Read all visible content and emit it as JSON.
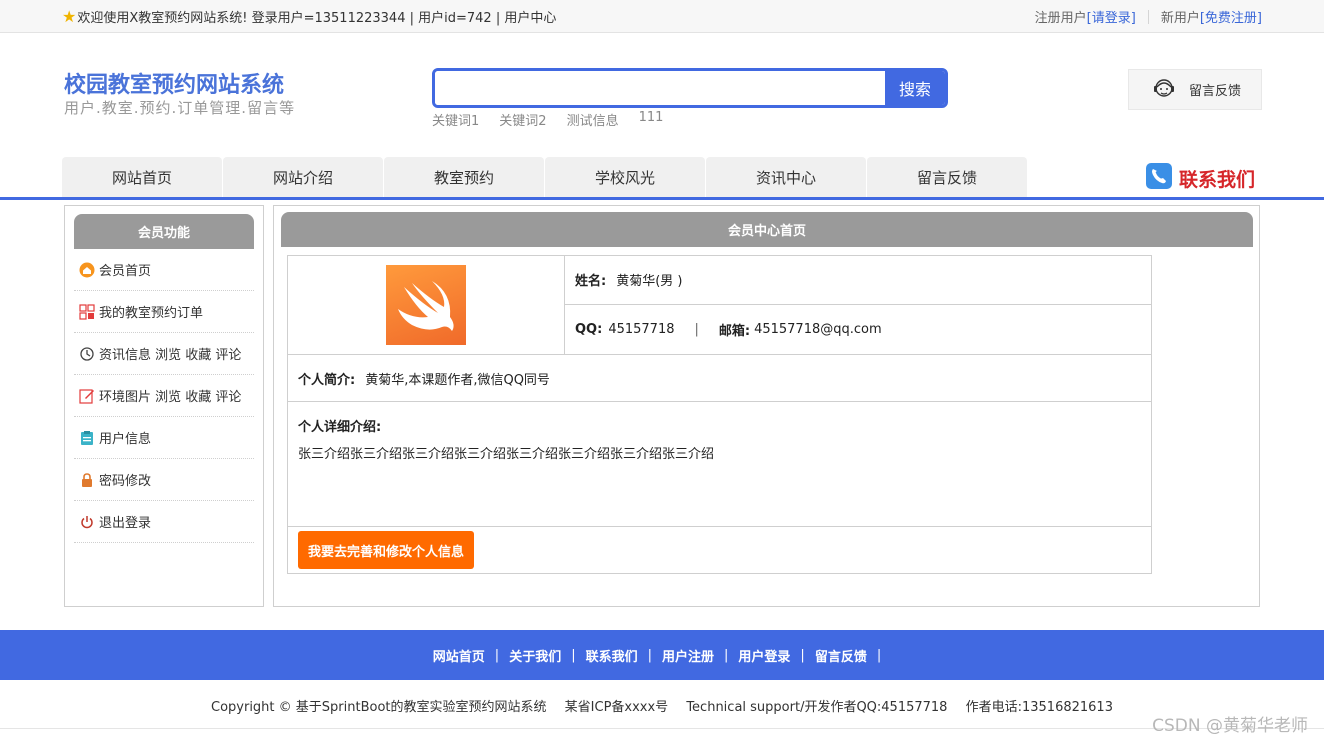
{
  "topbar": {
    "welcome": "欢迎使用X教室预约网站系统!  登录用户=13511223344 | 用户id=742 | 用户中心",
    "registered_label": "注册用户",
    "login_link": "[请登录]",
    "new_user_label": "新用户",
    "register_link": "[免费注册]"
  },
  "header": {
    "title": "校园教室预约网站系统",
    "subtitle": "用户.教室.预约.订单管理.留言等",
    "search": {
      "placeholder": "",
      "button": "搜索",
      "keywords": [
        "关键词1",
        "关键词2",
        "测试信息",
        "111"
      ]
    },
    "feedback": "留言反馈",
    "contact": "联系我们"
  },
  "nav": {
    "items": [
      "网站首页",
      "网站介绍",
      "教室预约",
      "学校风光",
      "资讯中心",
      "留言反馈"
    ]
  },
  "sidebar": {
    "title": "会员功能",
    "items": [
      {
        "label": "会员首页",
        "icon": "home-icon"
      },
      {
        "label": "我的教室预约订单",
        "icon": "grid-icon"
      },
      {
        "label": "资讯信息 浏览 收藏 评论",
        "icon": "history-icon"
      },
      {
        "label": "环境图片 浏览 收藏 评论",
        "icon": "edit-icon"
      },
      {
        "label": "用户信息",
        "icon": "clipboard-icon"
      },
      {
        "label": "密码修改",
        "icon": "lock-icon"
      },
      {
        "label": "退出登录",
        "icon": "power-icon"
      }
    ]
  },
  "main": {
    "title": "会员中心首页",
    "name_label": "姓名:",
    "name_value": "黄菊华(男 )",
    "qq_label": "QQ:",
    "qq_value": "45157718",
    "email_label": "邮箱:",
    "email_value": "45157718@qq.com",
    "intro_label": "个人简介:",
    "intro_value": "黄菊华,本课题作者,微信QQ同号",
    "detail_label": "个人详细介绍:",
    "detail_value": "张三介绍张三介绍张三介绍张三介绍张三介绍张三介绍张三介绍张三介绍",
    "edit_button": "我要去完善和修改个人信息"
  },
  "footer": {
    "nav": [
      "网站首页",
      "关于我们",
      "联系我们",
      "用户注册",
      "用户登录",
      "留言反馈"
    ],
    "copyright": "Copyright © 基于SprintBoot的教室实验室预约网站系统",
    "icp": "某省ICP备xxxx号",
    "support": "Technical support/开发作者QQ:45157718",
    "phone": "作者电话:13516821613"
  },
  "watermark": "CSDN @黄菊华老师",
  "colors": {
    "primary": "#4169e1",
    "accent": "#ff6a00",
    "header_gray": "#9a9a9a"
  }
}
